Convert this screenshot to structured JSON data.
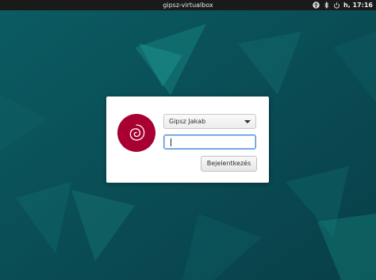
{
  "topbar": {
    "hostname": "gipsz-virtualbox",
    "clock": "h, 17:16",
    "icons": [
      "accessibility-icon",
      "bluetooth-icon",
      "power-icon"
    ]
  },
  "login": {
    "selected_user": "Gipsz Jakab",
    "password_value": "",
    "login_button_label": "Bejelentkezés",
    "avatar_icon": "debian-swirl-icon"
  },
  "colors": {
    "topbar_bg": "#1a1a1a",
    "avatar_bg": "#a80030",
    "wallpaper_base": "#0a4f55",
    "focus_ring": "#4a90d9"
  }
}
